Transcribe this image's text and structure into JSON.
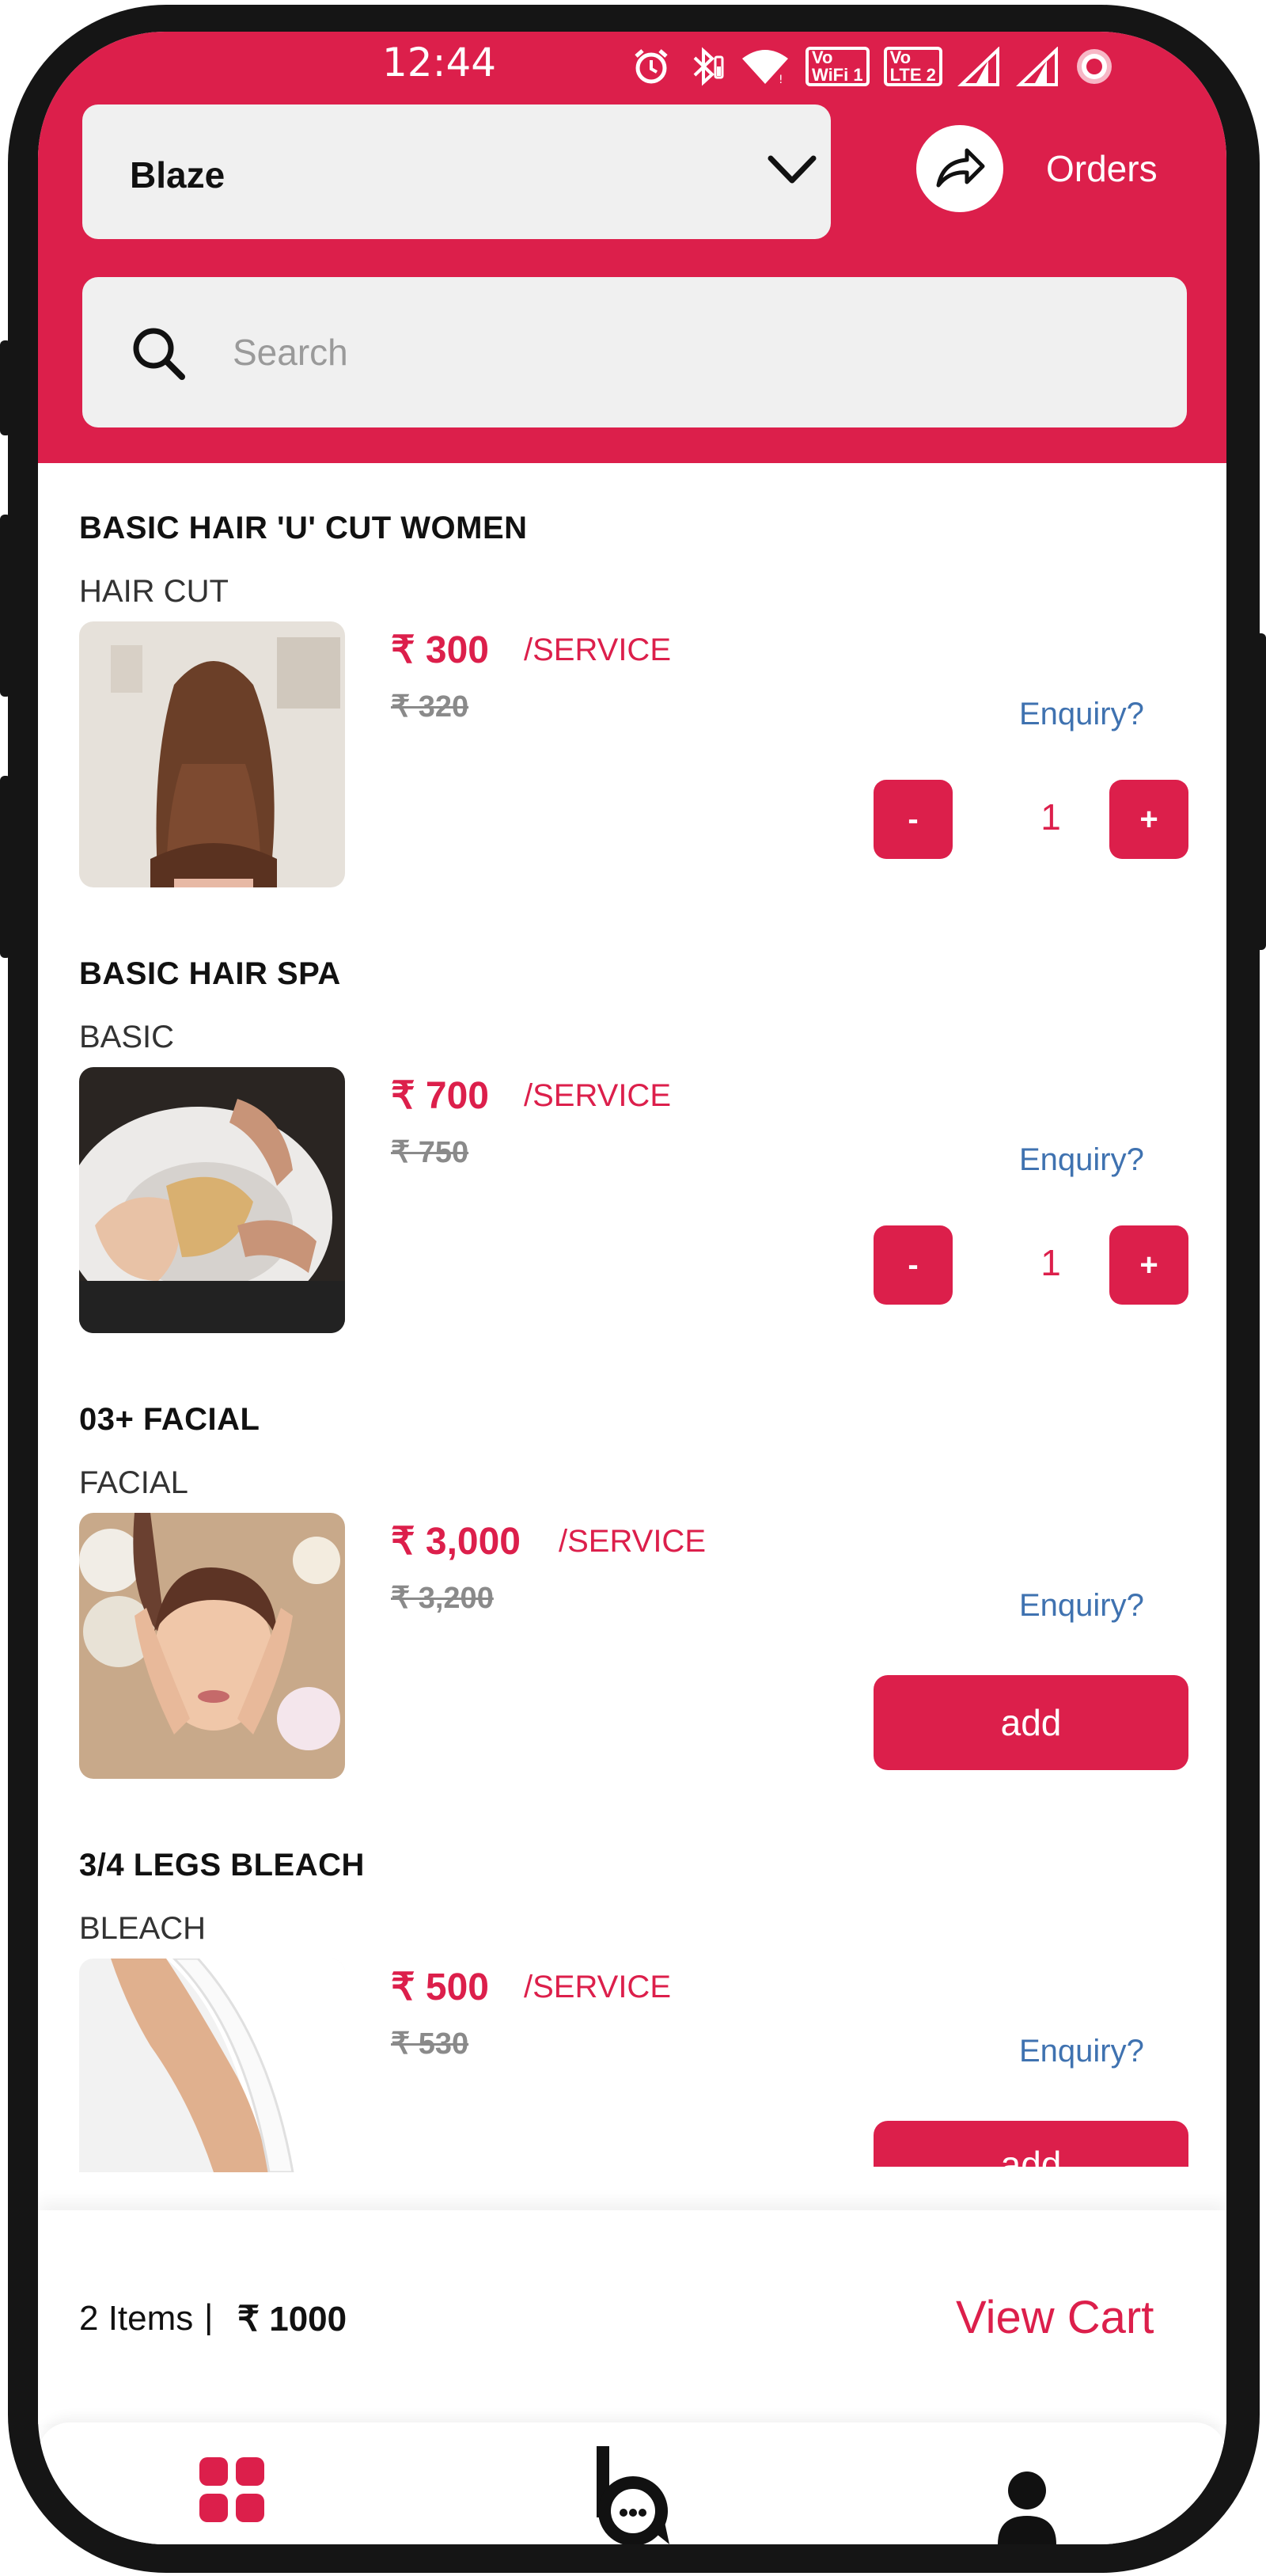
{
  "status_bar": {
    "time": "12:44",
    "icons": [
      "alarm-icon",
      "bluetooth-icon",
      "wifi-icon",
      "vowifi-icon",
      "volte-icon",
      "signal-icon",
      "signal-icon",
      "record-icon"
    ],
    "vowifi_top": "Vo",
    "vowifi_bottom": "WiFi 1",
    "volte_top": "Vo",
    "volte_bottom": "LTE 2"
  },
  "header": {
    "store_selected": "Blaze",
    "orders_label": "Orders"
  },
  "search": {
    "placeholder": "Search"
  },
  "services": [
    {
      "name": "BASIC HAIR 'U' CUT WOMEN",
      "category": "HAIR CUT",
      "price": "₹ 300",
      "per": "/SERVICE",
      "old_price": "₹ 320",
      "enquiry": "Enquiry?",
      "qty": "1",
      "minus": "-",
      "plus": "+"
    },
    {
      "name": "BASIC HAIR SPA",
      "category": "BASIC",
      "price": "₹ 700",
      "per": "/SERVICE",
      "old_price": "₹ 750",
      "enquiry": "Enquiry?",
      "qty": "1",
      "minus": "-",
      "plus": "+"
    },
    {
      "name": "03+ FACIAL",
      "category": "FACIAL",
      "price": "₹ 3,000",
      "per": "/SERVICE",
      "old_price": "₹ 3,200",
      "enquiry": "Enquiry?",
      "add": "add"
    },
    {
      "name": "3/4 LEGS BLEACH",
      "category": "BLEACH",
      "price": "₹ 500",
      "per": "/SERVICE",
      "old_price": "₹ 530",
      "enquiry": "Enquiry?",
      "add": "add"
    }
  ],
  "cart": {
    "items": "2 Items",
    "separator": "|",
    "total": "₹ 1000",
    "view_cart": "View Cart"
  },
  "bottom_nav": {
    "icons": [
      "grid-icon",
      "chat-logo-icon",
      "profile-icon"
    ]
  },
  "colors": {
    "brand": "#dc1f4b",
    "enquiry": "#3f72b0",
    "field_bg": "#f0f0f0"
  }
}
